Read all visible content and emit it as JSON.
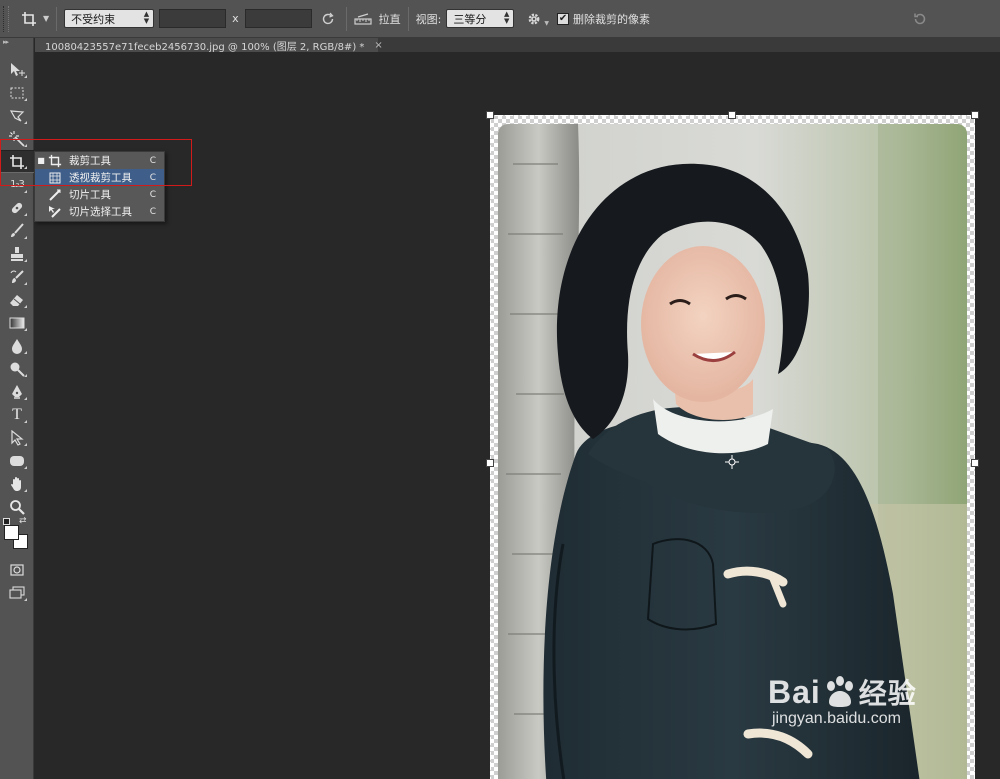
{
  "options_bar": {
    "preset_icon": "crop-icon",
    "ratio_select": "不受约束",
    "width_value": "",
    "height_value": "",
    "x_label": "x",
    "straighten_label": "拉直",
    "view_label": "视图:",
    "view_select": "三等分",
    "delete_pixels_label": "删除裁剪的像素",
    "delete_pixels_checked": true
  },
  "document_tab": {
    "title": "10080423557e71feceb2456730.jpg @ 100% (图层 2, RGB/8#) *",
    "close": "×"
  },
  "toolbar": {
    "collapse": "▸▸",
    "tools": [
      "move-tool",
      "marquee-tool",
      "lasso-tool",
      "magic-wand-tool",
      "crop-tool",
      "eyedropper-tool",
      "healing-brush-tool",
      "brush-tool",
      "clone-stamp-tool",
      "history-brush-tool",
      "eraser-tool",
      "gradient-tool",
      "blur-tool",
      "dodge-tool",
      "pen-tool",
      "type-tool",
      "path-selection-tool",
      "shape-tool",
      "hand-tool",
      "zoom-tool"
    ],
    "type_glyph": "T",
    "count_glyph": "1₂3",
    "active_tool": "crop-tool"
  },
  "flyout_menu": {
    "items": [
      {
        "label": "裁剪工具",
        "shortcut": "C",
        "icon": "crop-icon",
        "selected": true
      },
      {
        "label": "透视裁剪工具",
        "shortcut": "C",
        "icon": "perspective-crop-icon",
        "hover": true
      },
      {
        "label": "切片工具",
        "shortcut": "C",
        "icon": "slice-icon"
      },
      {
        "label": "切片选择工具",
        "shortcut": "C",
        "icon": "slice-select-icon"
      }
    ]
  },
  "watermark": {
    "brand_left": "Bai",
    "brand_right": "经验",
    "url": "jingyan.baidu.com"
  },
  "colors": {
    "panel": "#535353",
    "canvas": "#282828",
    "highlight": "#d11a1a",
    "menu_hover": "#3f5f8a"
  }
}
